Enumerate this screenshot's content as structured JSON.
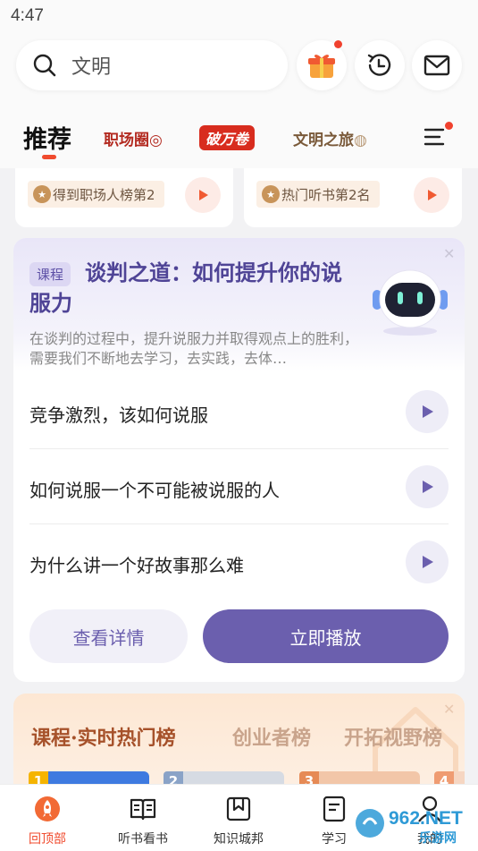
{
  "status_bar": {
    "time": "4:47"
  },
  "search": {
    "placeholder_text": "文明"
  },
  "header_icons": [
    "gift-icon",
    "history-icon",
    "mail-icon"
  ],
  "tabs": {
    "active": "推荐",
    "brands": [
      "职场圈",
      "破万卷",
      "文明之旅"
    ]
  },
  "mini_cards": [
    {
      "badge": "得到职场人榜第2"
    },
    {
      "badge": "热门听书第2名"
    }
  ],
  "course": {
    "tag": "课程",
    "title": "谈判之道：如何提升你的说服力",
    "description": "在谈判的过程中，提升说服力并取得观点上的胜利，需要我们不断地去学习，去实践，去体…",
    "items": [
      {
        "title": "竞争激烈，该如何说服"
      },
      {
        "title": "如何说服一个不可能被说服的人"
      },
      {
        "title": "为什么讲一个好故事那么难"
      }
    ],
    "detail_button": "查看详情",
    "play_button": "立即播放"
  },
  "hot": {
    "tabs": [
      "课程·实时热门榜",
      "创业者榜",
      "开拓视野榜"
    ],
    "ranks": [
      "1",
      "2",
      "3",
      "4"
    ]
  },
  "bottom_nav": [
    {
      "label": "回顶部",
      "icon": "rocket-icon",
      "active": true
    },
    {
      "label": "听书看书",
      "icon": "book-icon",
      "active": false
    },
    {
      "label": "知识城邦",
      "icon": "bookmark-icon",
      "active": false
    },
    {
      "label": "学习",
      "icon": "notes-icon",
      "active": false
    },
    {
      "label": "我的",
      "icon": "user-icon",
      "active": false
    }
  ],
  "watermark": {
    "text": "962.NET",
    "sub": "乐游网"
  },
  "colors": {
    "accent": "#f04b2e",
    "course_purple": "#6b5fae",
    "hot_brown": "#a6512a"
  }
}
